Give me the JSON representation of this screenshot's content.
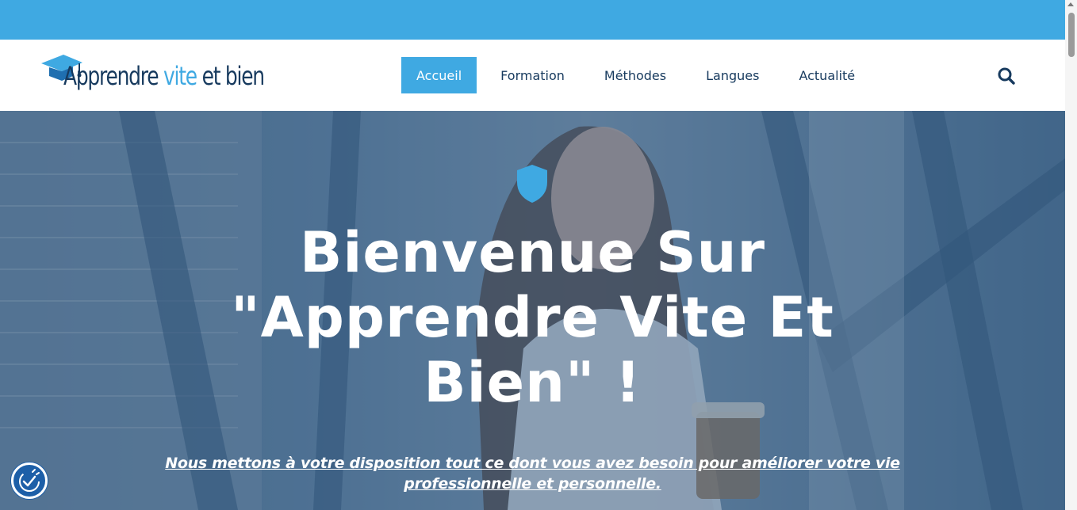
{
  "header": {
    "logo": {
      "word1": "Apprendre",
      "word2": "vite",
      "word3": "et bien"
    },
    "nav": [
      {
        "label": "Accueil",
        "active": true
      },
      {
        "label": "Formation",
        "active": false
      },
      {
        "label": "Méthodes",
        "active": false
      },
      {
        "label": "Langues",
        "active": false
      },
      {
        "label": "Actualité",
        "active": false
      }
    ],
    "search_icon": "search-icon"
  },
  "hero": {
    "title": "Bienvenue Sur \"Apprendre Vite Et Bien\" !",
    "subtitle": "Nous mettons à votre disposition tout ce dont vous avez besoin pour améliorer votre vie professionnelle et personnelle.",
    "icon": "shield-icon"
  },
  "accessibility": {
    "icon": "accessibility-icon"
  },
  "colors": {
    "accent": "#3fa9e2",
    "navy": "#173a5e",
    "a11y": "#1d5fa8"
  }
}
